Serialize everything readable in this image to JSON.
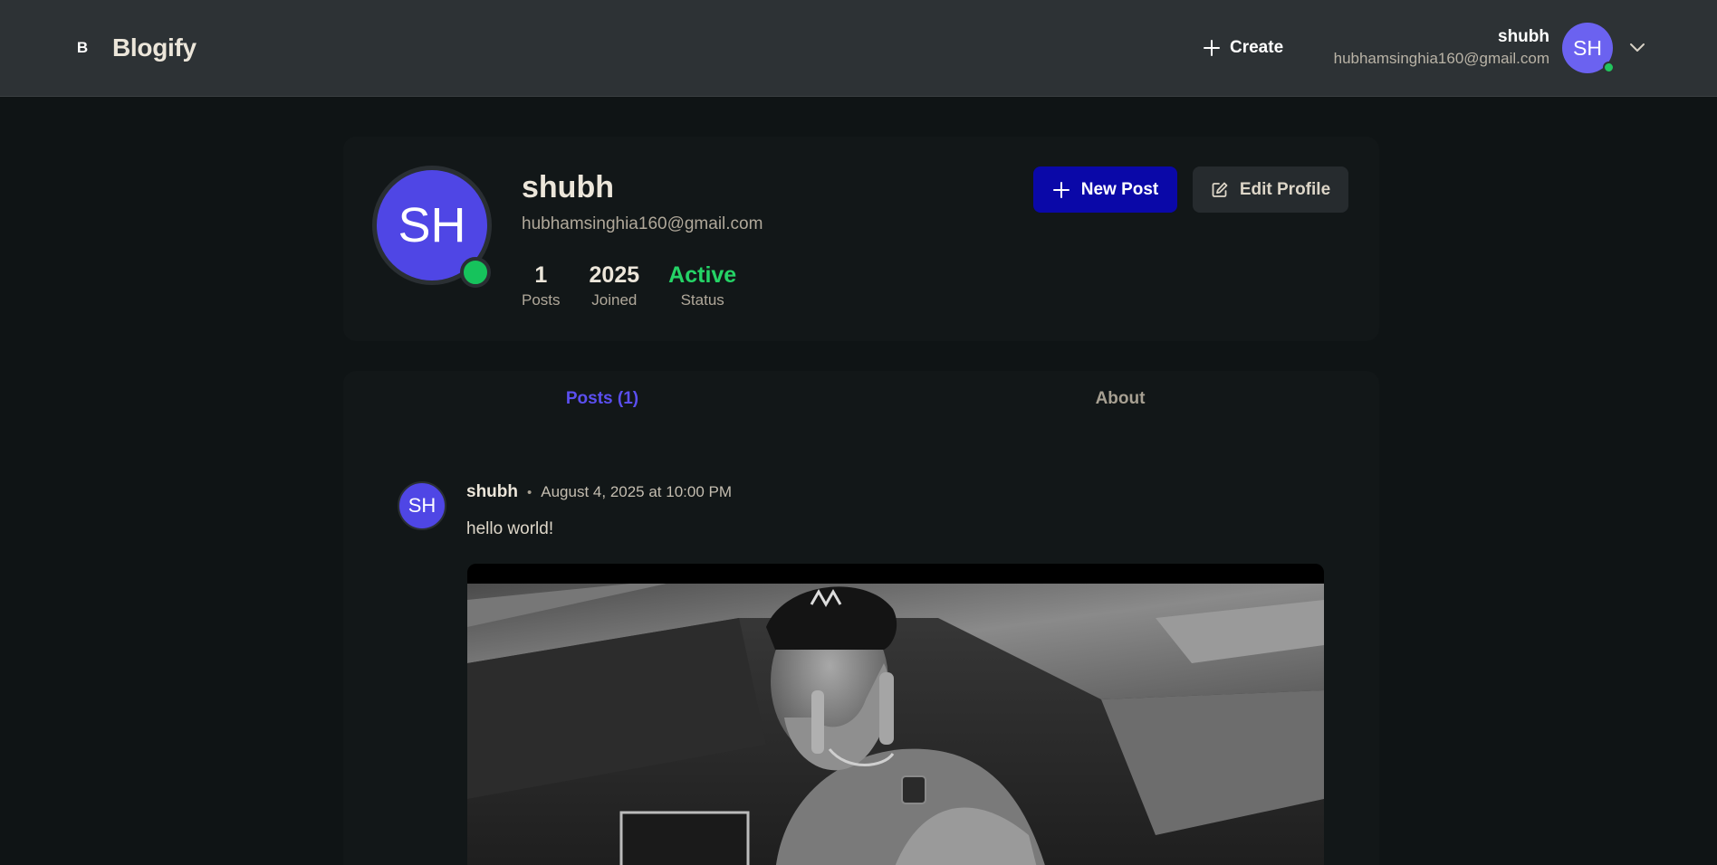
{
  "header": {
    "brand_mark": "B",
    "brand_name": "Blogify",
    "create_label": "Create",
    "user_name": "shubh",
    "user_email": "hubhamsinghia160@gmail.com",
    "avatar_initials": "SH"
  },
  "profile": {
    "initials": "SH",
    "name": "shubh",
    "email": "hubhamsinghia160@gmail.com",
    "stats": [
      {
        "value": "1",
        "label": "Posts"
      },
      {
        "value": "2025",
        "label": "Joined"
      },
      {
        "value": "Active",
        "label": "Status"
      }
    ],
    "new_post_label": "New Post",
    "edit_profile_label": "Edit Profile"
  },
  "tabs": [
    {
      "label": "Posts (1)",
      "active": true
    },
    {
      "label": "About",
      "active": false
    }
  ],
  "post": {
    "avatar_initials": "SH",
    "author": "shubh",
    "separator": "•",
    "date": "August 4, 2025 at 10:00 PM",
    "text": "hello world!"
  },
  "colors": {
    "page_bg": "#0f1415",
    "header_bg": "#2d3235",
    "card_bg": "#121718",
    "accent": "#4f46e5",
    "primary_button": "#0a08a8",
    "active_tab": "#5b4ff0",
    "online": "#22c55e"
  }
}
